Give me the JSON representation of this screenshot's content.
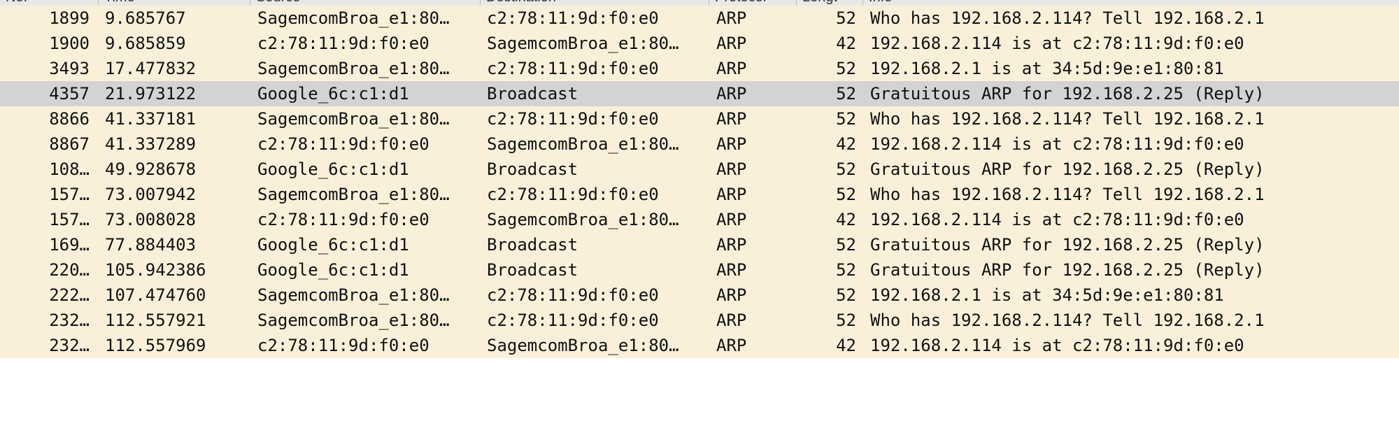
{
  "columns": {
    "no": "No.",
    "time": "Time",
    "source": "Source",
    "destination": "Destination",
    "protocol": "Protocol",
    "length": "Lengt",
    "info": "Info"
  },
  "rows": [
    {
      "no": "1899",
      "time": "9.685767",
      "source": "SagemcomBroa_e1:80…",
      "destination": "c2:78:11:9d:f0:e0",
      "protocol": "ARP",
      "length": "52",
      "info": "Who has 192.168.2.114? Tell 192.168.2.1",
      "selected": false
    },
    {
      "no": "1900",
      "time": "9.685859",
      "source": "c2:78:11:9d:f0:e0",
      "destination": "SagemcomBroa_e1:80…",
      "protocol": "ARP",
      "length": "42",
      "info": "192.168.2.114 is at c2:78:11:9d:f0:e0",
      "selected": false
    },
    {
      "no": "3493",
      "time": "17.477832",
      "source": "SagemcomBroa_e1:80…",
      "destination": "c2:78:11:9d:f0:e0",
      "protocol": "ARP",
      "length": "52",
      "info": "192.168.2.1 is at 34:5d:9e:e1:80:81",
      "selected": false
    },
    {
      "no": "4357",
      "time": "21.973122",
      "source": "Google_6c:c1:d1",
      "destination": "Broadcast",
      "protocol": "ARP",
      "length": "52",
      "info": "Gratuitous ARP for 192.168.2.25 (Reply)",
      "selected": true
    },
    {
      "no": "8866",
      "time": "41.337181",
      "source": "SagemcomBroa_e1:80…",
      "destination": "c2:78:11:9d:f0:e0",
      "protocol": "ARP",
      "length": "52",
      "info": "Who has 192.168.2.114? Tell 192.168.2.1",
      "selected": false
    },
    {
      "no": "8867",
      "time": "41.337289",
      "source": "c2:78:11:9d:f0:e0",
      "destination": "SagemcomBroa_e1:80…",
      "protocol": "ARP",
      "length": "42",
      "info": "192.168.2.114 is at c2:78:11:9d:f0:e0",
      "selected": false
    },
    {
      "no": "108…",
      "time": "49.928678",
      "source": "Google_6c:c1:d1",
      "destination": "Broadcast",
      "protocol": "ARP",
      "length": "52",
      "info": "Gratuitous ARP for 192.168.2.25 (Reply)",
      "selected": false
    },
    {
      "no": "157…",
      "time": "73.007942",
      "source": "SagemcomBroa_e1:80…",
      "destination": "c2:78:11:9d:f0:e0",
      "protocol": "ARP",
      "length": "52",
      "info": "Who has 192.168.2.114? Tell 192.168.2.1",
      "selected": false
    },
    {
      "no": "157…",
      "time": "73.008028",
      "source": "c2:78:11:9d:f0:e0",
      "destination": "SagemcomBroa_e1:80…",
      "protocol": "ARP",
      "length": "42",
      "info": "192.168.2.114 is at c2:78:11:9d:f0:e0",
      "selected": false
    },
    {
      "no": "169…",
      "time": "77.884403",
      "source": "Google_6c:c1:d1",
      "destination": "Broadcast",
      "protocol": "ARP",
      "length": "52",
      "info": "Gratuitous ARP for 192.168.2.25 (Reply)",
      "selected": false
    },
    {
      "no": "220…",
      "time": "105.942386",
      "source": "Google_6c:c1:d1",
      "destination": "Broadcast",
      "protocol": "ARP",
      "length": "52",
      "info": "Gratuitous ARP for 192.168.2.25 (Reply)",
      "selected": false
    },
    {
      "no": "222…",
      "time": "107.474760",
      "source": "SagemcomBroa_e1:80…",
      "destination": "c2:78:11:9d:f0:e0",
      "protocol": "ARP",
      "length": "52",
      "info": "192.168.2.1 is at 34:5d:9e:e1:80:81",
      "selected": false
    },
    {
      "no": "232…",
      "time": "112.557921",
      "source": "SagemcomBroa_e1:80…",
      "destination": "c2:78:11:9d:f0:e0",
      "protocol": "ARP",
      "length": "52",
      "info": "Who has 192.168.2.114? Tell 192.168.2.1",
      "selected": false
    },
    {
      "no": "232…",
      "time": "112.557969",
      "source": "c2:78:11:9d:f0:e0",
      "destination": "SagemcomBroa_e1:80…",
      "protocol": "ARP",
      "length": "42",
      "info": "192.168.2.114 is at c2:78:11:9d:f0:e0",
      "selected": false
    }
  ],
  "colors": {
    "row_background": "#faf0da",
    "selected_background": "#d3d3d3",
    "empty_background": "#ffffff"
  }
}
